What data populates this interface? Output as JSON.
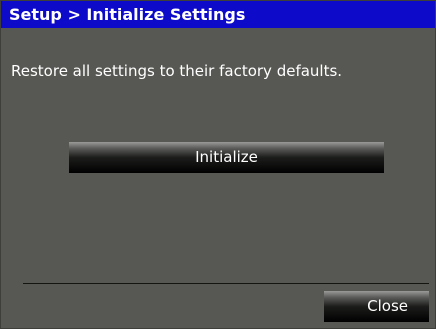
{
  "dialog": {
    "title": "Setup > Initialize Settings",
    "description": "Restore all settings to their factory defaults.",
    "initialize_label": "Initialize",
    "close_label": "Close"
  },
  "colors": {
    "title_bar": "#0e0ac9",
    "panel": "#575853",
    "text": "#ffffff"
  }
}
